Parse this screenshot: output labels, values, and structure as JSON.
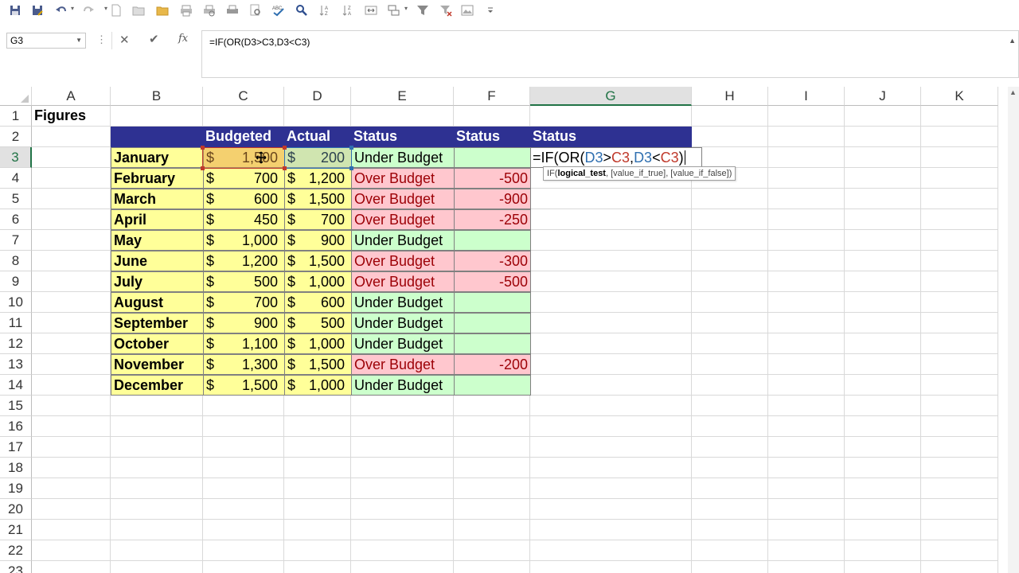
{
  "toolbar": {
    "icons": [
      "save-icon",
      "save-as-icon",
      "undo-icon",
      "redo-icon",
      "new-icon",
      "open-icon",
      "folder-icon",
      "print-icon",
      "print-preview-icon",
      "quick-print-icon",
      "search-icon",
      "spelling-icon",
      "find-icon",
      "sort-ascending-icon",
      "sort-descending-icon",
      "merge-icon",
      "format-icon",
      "filter-icon",
      "clear-filter-icon",
      "picture-icon",
      "customize-icon"
    ]
  },
  "formula_bar": {
    "name_box": "G3",
    "cancel": "✕",
    "enter": "✔",
    "insert_function": "fx",
    "formula": "=IF(OR(D3>C3,D3<C3)"
  },
  "columns": [
    "A",
    "B",
    "C",
    "D",
    "E",
    "F",
    "G",
    "H",
    "I",
    "J",
    "K"
  ],
  "rows": [
    "1",
    "2",
    "3",
    "4",
    "5",
    "6",
    "7",
    "8",
    "9",
    "10",
    "11",
    "12",
    "13",
    "14",
    "15",
    "16",
    "17",
    "18",
    "19",
    "20",
    "21",
    "22",
    "23"
  ],
  "sheet": {
    "title": "Figures",
    "headers": {
      "budgeted": "Budgeted",
      "actual": "Actual",
      "status_e": "Status",
      "status_f": "Status",
      "status_g": "Status"
    },
    "currency": "$",
    "records": [
      {
        "month": "January",
        "budgeted": "1,500",
        "actual": "200",
        "status": "Under Budget",
        "diff": ""
      },
      {
        "month": "February",
        "budgeted": "700",
        "actual": "1,200",
        "status": "Over Budget",
        "diff": "-500"
      },
      {
        "month": "March",
        "budgeted": "600",
        "actual": "1,500",
        "status": "Over Budget",
        "diff": "-900"
      },
      {
        "month": "April",
        "budgeted": "450",
        "actual": "700",
        "status": "Over Budget",
        "diff": "-250"
      },
      {
        "month": "May",
        "budgeted": "1,000",
        "actual": "900",
        "status": "Under Budget",
        "diff": ""
      },
      {
        "month": "June",
        "budgeted": "1,200",
        "actual": "1,500",
        "status": "Over Budget",
        "diff": "-300"
      },
      {
        "month": "July",
        "budgeted": "500",
        "actual": "1,000",
        "status": "Over Budget",
        "diff": "-500"
      },
      {
        "month": "August",
        "budgeted": "700",
        "actual": "600",
        "status": "Under Budget",
        "diff": ""
      },
      {
        "month": "September",
        "budgeted": "900",
        "actual": "500",
        "status": "Under Budget",
        "diff": ""
      },
      {
        "month": "October",
        "budgeted": "1,100",
        "actual": "1,000",
        "status": "Under Budget",
        "diff": ""
      },
      {
        "month": "November",
        "budgeted": "1,300",
        "actual": "1,500",
        "status": "Over Budget",
        "diff": "-200"
      },
      {
        "month": "December",
        "budgeted": "1,500",
        "actual": "1,000",
        "status": "Under Budget",
        "diff": ""
      }
    ]
  },
  "edit": {
    "parts": [
      "=IF(OR(",
      "D3",
      ">",
      "C3",
      ",",
      "D3",
      "<",
      "C3",
      ")"
    ],
    "tooltip_fn": "IF(",
    "tooltip_bold": "logical_test",
    "tooltip_rest": ", [value_if_true], [value_if_false])"
  },
  "colors": {
    "header_bg": "#2e3192",
    "month_bg": "#ffff99",
    "under_bg": "#ccffcc",
    "over_bg": "#ffc7ce",
    "over_text": "#9c0006",
    "accent": "#217346"
  }
}
